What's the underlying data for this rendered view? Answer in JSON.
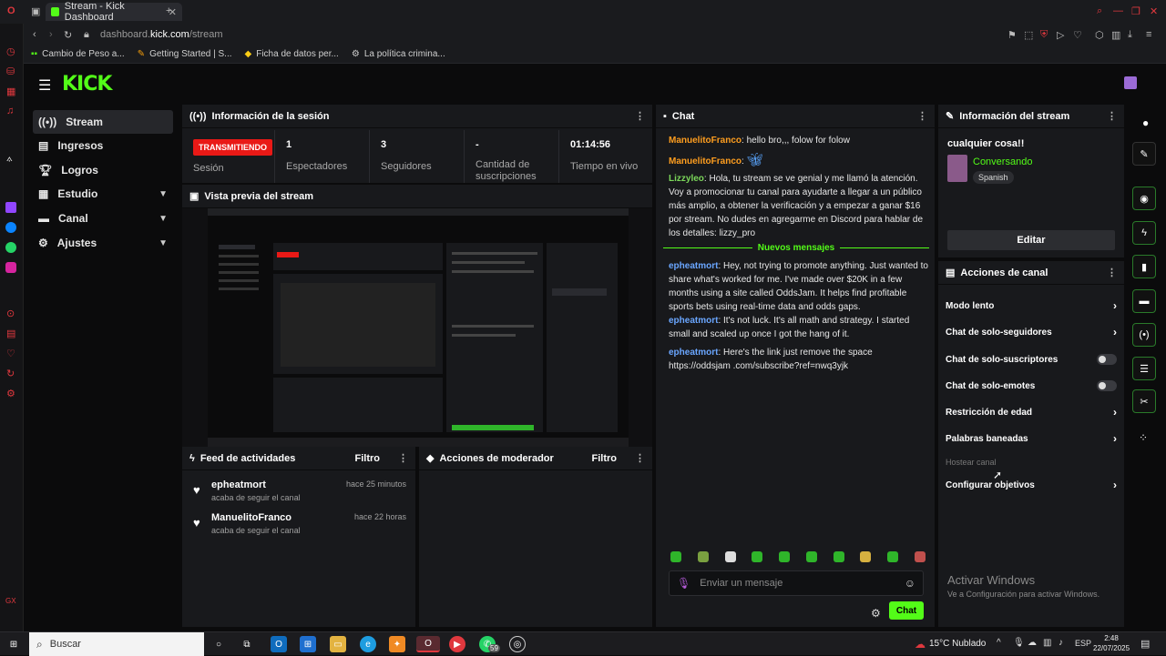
{
  "browser": {
    "tab_title": "Stream - Kick Dashboard",
    "url_prefix": "dashboard.",
    "url_domain": "kick.com",
    "url_path": "/stream",
    "bookmarks": [
      "Cambio de Peso a...",
      "Getting Started | S...",
      "Ficha de datos per...",
      "La política crimina..."
    ]
  },
  "logo": "KICK",
  "sidebar": {
    "items": [
      {
        "label": "Stream"
      },
      {
        "label": "Ingresos"
      },
      {
        "label": "Logros"
      },
      {
        "label": "Estudio"
      },
      {
        "label": "Canal"
      },
      {
        "label": "Ajustes"
      }
    ]
  },
  "session": {
    "title": "Información de la sesión",
    "status_badge": "TRANSMITIENDO",
    "status_label": "Sesión",
    "viewers_value": "1",
    "viewers_label": "Espectadores",
    "followers_value": "3",
    "followers_label": "Seguidores",
    "subs_value": "-",
    "subs_label": "Cantidad de suscripciones",
    "uptime_value": "01:14:56",
    "uptime_label": "Tiempo en vivo"
  },
  "preview": {
    "title": "Vista previa del stream"
  },
  "feed": {
    "title": "Feed de actividades",
    "filter": "Filtro",
    "items": [
      {
        "name": "epheatmort",
        "sub": "acaba de seguir el canal",
        "time": "hace 25 minutos"
      },
      {
        "name": "ManuelitoFranco",
        "sub": "acaba de seguir el canal",
        "time": "hace 22 horas"
      }
    ]
  },
  "mod_actions": {
    "title": "Acciones de moderador",
    "filter": "Filtro"
  },
  "chat": {
    "title": "Chat",
    "messages": [
      {
        "user": "ManuelitoFranco",
        "color": "#ff9e1f",
        "text": "hello bro,,, folow for folow"
      },
      {
        "user": "ManuelitoFranco",
        "color": "#ff9e1f",
        "text": ""
      },
      {
        "user": "Lizzyleo",
        "color": "#7bd65a",
        "text": "Hola, tu stream se ve genial y me llamó la atención. Voy a promocionar tu canal para ayudarte a llegar a un público más amplio, a obtener la verificación y a empezar a ganar $16 por stream. No dudes en agregarme en Discord para hablar de los detalles: lizzy_pro"
      }
    ],
    "new_messages": "Nuevos mensajes",
    "new": [
      {
        "user": "epheatmort",
        "color": "#6aa6ff",
        "text": "Hey, not trying to promote anything. Just wanted to share what's worked for me. I've made over $20K in a few months using a site called OddsJam. It helps find profitable sports bets using real-time data and odds gaps."
      },
      {
        "user": "epheatmort",
        "color": "#6aa6ff",
        "text": "It's not luck. It's all math and strategy. I started small and scaled up once I got the hang of it."
      },
      {
        "user": "epheatmort",
        "color": "#6aa6ff",
        "text": "Here's the link just remove the space https://oddsjam .com/subscribe?ref=nwq3yjk"
      }
    ],
    "input_placeholder": "Enviar un mensaje",
    "send_label": "Chat"
  },
  "stream_info": {
    "title": "Información del stream",
    "stream_title": "cualquier cosa!!",
    "category": "Conversando",
    "language": "Spanish",
    "edit_label": "Editar"
  },
  "channel_actions": {
    "title": "Acciones de canal",
    "items": [
      {
        "label": "Modo lento",
        "control": "arrow"
      },
      {
        "label": "Chat de solo-seguidores",
        "control": "arrow"
      },
      {
        "label": "Chat de solo-suscriptores",
        "control": "toggle"
      },
      {
        "label": "Chat de solo-emotes",
        "control": "toggle"
      },
      {
        "label": "Restricción de edad",
        "control": "arrow"
      },
      {
        "label": "Palabras baneadas",
        "control": "arrow"
      },
      {
        "label": "Hostear canal",
        "control": "disabled"
      },
      {
        "label": "Configurar objetivos",
        "control": "arrow"
      }
    ]
  },
  "watermark": {
    "line1": "Activar Windows",
    "line2": "Ve a Configuración para activar Windows."
  },
  "taskbar": {
    "search_placeholder": "Buscar",
    "whatsapp_badge": "59",
    "weather": "15°C  Nublado",
    "lang": "ESP",
    "time": "2:48",
    "date": "22/07/2025"
  },
  "colors": {
    "accent": "#53fc18",
    "live": "#e91916",
    "panel": "#18191c"
  }
}
